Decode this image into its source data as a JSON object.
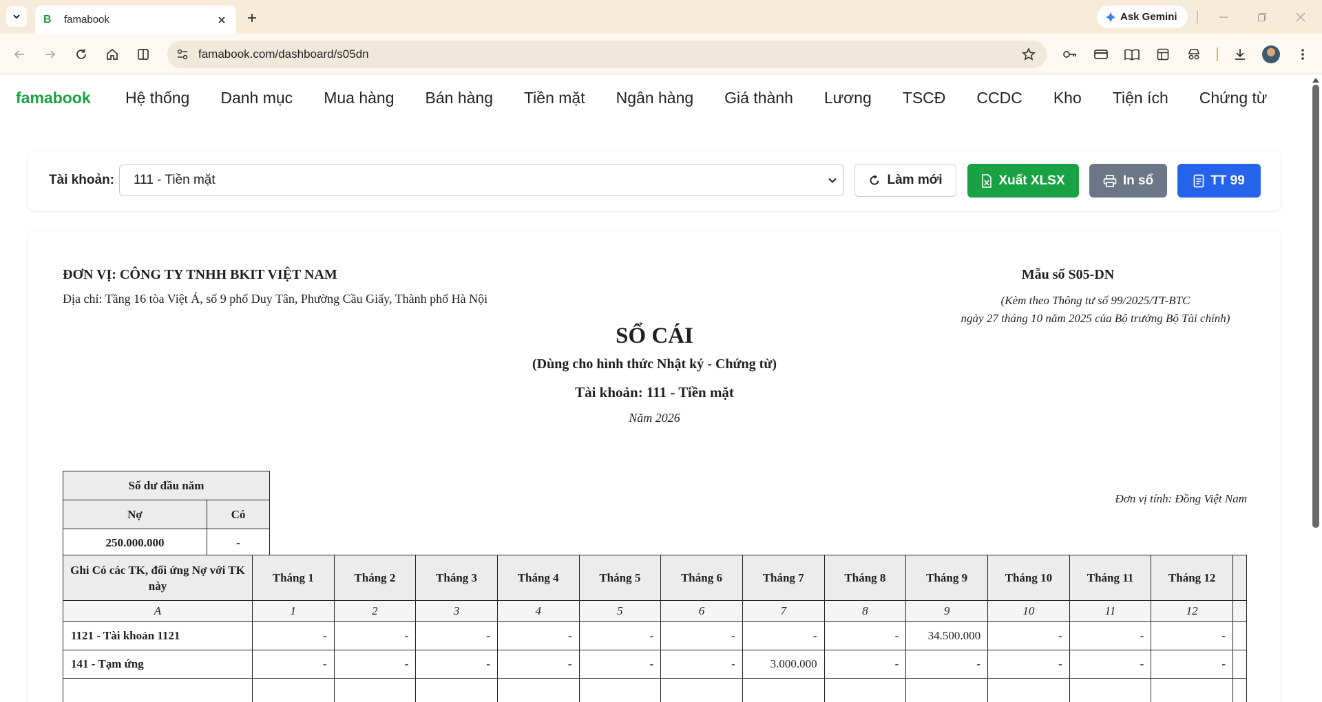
{
  "browser": {
    "tab_title": "famabook",
    "favicon_letter": "B",
    "url": "famabook.com/dashboard/s05dn",
    "gemini_label": "Ask Gemini"
  },
  "app": {
    "brand": "famabook",
    "menu": [
      "Hệ thống",
      "Danh mục",
      "Mua hàng",
      "Bán hàng",
      "Tiền mặt",
      "Ngân hàng",
      "Giá thành",
      "Lương",
      "TSCĐ",
      "CCDC",
      "Kho",
      "Tiện ích",
      "Chứng từ"
    ]
  },
  "filter": {
    "label": "Tài khoản:",
    "selected_account": "111 - Tiền mặt",
    "refresh_label": "Làm mới",
    "export_label": "Xuất XLSX",
    "print_label": "In sổ",
    "tt_label": "TT 99"
  },
  "document": {
    "unit_name": "ĐƠN VỊ: CÔNG TY TNHH BKIT VIỆT NAM",
    "address": "Địa chỉ: Tầng 16 tòa Việt Á, số 9 phố Duy Tân, Phường Cầu Giấy, Thành phố Hà Nội",
    "form_code": "Mẫu số S05-DN",
    "form_note_1": "(Kèm theo Thông tư số 99/2025/TT-BTC",
    "form_note_2": "ngày 27 tháng 10 năm 2025 của Bộ trưởng Bộ Tài chính)",
    "title": "SỔ CÁI",
    "subtitle": "(Dùng cho hình thức Nhật ký - Chứng từ)",
    "account_line": "Tài khoản: 111 - Tiền mặt",
    "year_line": "Năm 2026",
    "currency_unit": "Đơn vị tính: Đồng Việt Nam",
    "opening_balance": {
      "header": "Số dư đầu năm",
      "debit_label": "Nợ",
      "credit_label": "Có",
      "debit_value": "250.000.000",
      "credit_value": "-"
    },
    "ledger": {
      "first_col_header": "Ghi Có các TK, đối ứng Nợ với TK này",
      "months": [
        "Tháng 1",
        "Tháng 2",
        "Tháng 3",
        "Tháng 4",
        "Tháng 5",
        "Tháng 6",
        "Tháng 7",
        "Tháng 8",
        "Tháng 9",
        "Tháng 10",
        "Tháng 11",
        "Tháng 12"
      ],
      "index_row": [
        "A",
        "1",
        "2",
        "3",
        "4",
        "5",
        "6",
        "7",
        "8",
        "9",
        "10",
        "11",
        "12"
      ],
      "rows": [
        {
          "account": "1121 - Tài khoản 1121",
          "values": [
            "-",
            "-",
            "-",
            "-",
            "-",
            "-",
            "-",
            "-",
            "34.500.000",
            "-",
            "-",
            "-"
          ]
        },
        {
          "account": "141 - Tạm ứng",
          "values": [
            "-",
            "-",
            "-",
            "-",
            "-",
            "-",
            "3.000.000",
            "-",
            "-",
            "-",
            "-",
            "-"
          ]
        }
      ]
    }
  }
}
